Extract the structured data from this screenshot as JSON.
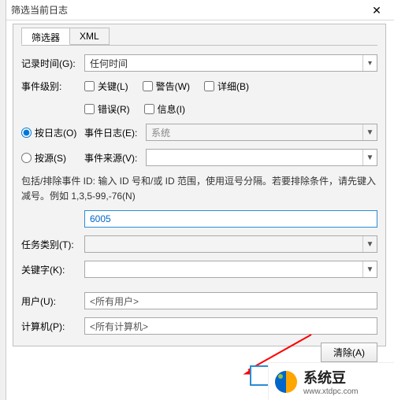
{
  "window": {
    "title": "筛选当前日志"
  },
  "tabs": {
    "filter": "筛选器",
    "xml": "XML"
  },
  "labels": {
    "logged_time": "记录时间(G):",
    "event_level": "事件级别:",
    "by_log": "按日志(O)",
    "by_source": "按源(S)",
    "event_log": "事件日志(E):",
    "event_source": "事件来源(V):",
    "task_category": "任务类别(T):",
    "keywords": "关键字(K):",
    "user": "用户(U):",
    "computer": "计算机(P):"
  },
  "time_options": {
    "selected": "任何时间"
  },
  "levels": {
    "critical": "关键(L)",
    "warning": "警告(W)",
    "verbose": "详细(B)",
    "error": "错误(R)",
    "information": "信息(I)"
  },
  "event_log_value": "系统",
  "instruction": "包括/排除事件 ID: 输入 ID 号和/或 ID 范围，使用逗号分隔。若要排除条件，请先键入减号。例如 1,3,5-99,-76(N)",
  "event_id_value": "6005",
  "user_value": "<所有用户>",
  "computer_value": "<所有计算机>",
  "buttons": {
    "clear": "清除(A)"
  },
  "watermark": {
    "brand": "系统豆",
    "url": "www.xtdpc.com"
  }
}
